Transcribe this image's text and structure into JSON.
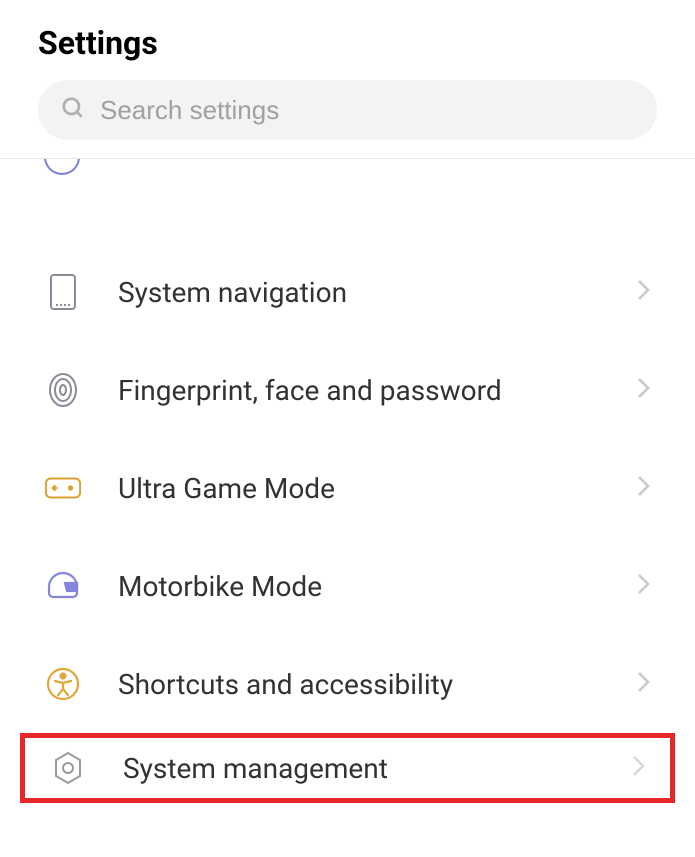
{
  "header": {
    "title": "Settings"
  },
  "search": {
    "placeholder": "Search settings"
  },
  "items": [
    {
      "label": "System navigation",
      "icon": "phone"
    },
    {
      "label": "Fingerprint, face and password",
      "icon": "fingerprint"
    },
    {
      "label": "Ultra Game Mode",
      "icon": "gamepad"
    },
    {
      "label": "Motorbike Mode",
      "icon": "helmet"
    },
    {
      "label": "Shortcuts and accessibility",
      "icon": "accessibility"
    },
    {
      "label": "System management",
      "icon": "gear",
      "highlighted": true
    }
  ]
}
